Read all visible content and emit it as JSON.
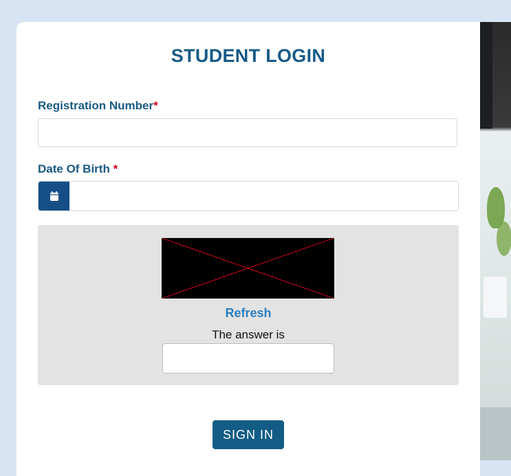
{
  "form": {
    "title": "STUDENT LOGIN",
    "registration": {
      "label": "Registration Number",
      "required_mark": "*",
      "value": ""
    },
    "dob": {
      "label": "Date Of Birth ",
      "required_mark": "*",
      "value": "",
      "icon": "calendar-icon"
    },
    "captcha": {
      "image": "broken-image",
      "refresh_label": "Refresh",
      "answer_label": "The answer is",
      "answer_value": ""
    },
    "submit_label": "SIGN IN"
  },
  "colors": {
    "page_bg": "#d6e4f3",
    "title": "#155a87",
    "label": "#1a5a84",
    "required": "#d0021b",
    "calendar_button": "#164f86",
    "captcha_bg": "#e3e3e3",
    "refresh_link": "#2a7fbf",
    "sign_in_button": "#135c86"
  }
}
